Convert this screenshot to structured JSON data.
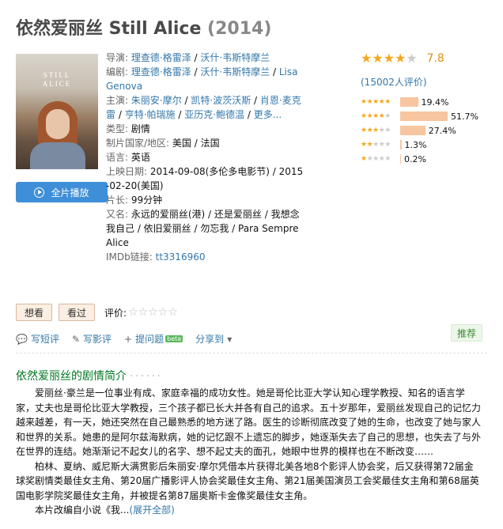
{
  "title": {
    "name": "依然爱丽丝 Still Alice",
    "year": "(2014)"
  },
  "poster": {
    "text": "STILL\nALICE",
    "alt": "poster"
  },
  "play_button": {
    "label": "全片播放",
    "icon": "play-circle-icon"
  },
  "info": {
    "director_label": "导演:",
    "director": [
      "理查德·格雷泽",
      "沃什·韦斯特摩兰"
    ],
    "writer_label": "编剧:",
    "writer": [
      "理查德·格雷泽",
      "沃什·韦斯特摩兰",
      "Lisa Genova"
    ],
    "cast_label": "主演:",
    "cast": [
      "朱丽安·摩尔",
      "凯特·波茨沃斯",
      "肖恩·麦克雷",
      "亨特·帕瑞施",
      "亚历克·鲍德温",
      "更多..."
    ],
    "genre_label": "类型:",
    "genre": "剧情",
    "country_label": "制片国家/地区:",
    "country": "美国 / 法国",
    "language_label": "语言:",
    "language": "英语",
    "release_label": "上映日期:",
    "release": "2014-09-08(多伦多电影节) / 2015-02-20(美国)",
    "runtime_label": "片长:",
    "runtime": "99分钟",
    "aka_label": "又名:",
    "aka": "永远的爱丽丝(港) / 还是爱丽丝 / 我想念我自己 / 依旧爱丽丝 / 勿忘我 / Para Sempre Alice",
    "imdb_label": "IMDb链接:",
    "imdb": "tt3316960"
  },
  "rating": {
    "score": "7.8",
    "stars_filled": 4,
    "votes": "(15002人评价)",
    "distribution": [
      {
        "stars": 5,
        "percent": "19.4%",
        "value": 19.4
      },
      {
        "stars": 4,
        "percent": "51.7%",
        "value": 51.7
      },
      {
        "stars": 3,
        "percent": "27.4%",
        "value": 27.4
      },
      {
        "stars": 2,
        "percent": "1.3%",
        "value": 1.3
      },
      {
        "stars": 1,
        "percent": "0.2%",
        "value": 0.2
      }
    ],
    "star_color": "#f4a81d"
  },
  "actions": {
    "want": "想看",
    "seen": "看过",
    "rate_label": "评价:"
  },
  "tools": {
    "short_review": "写短评",
    "review": "写影评",
    "question": "提问题",
    "beta": "beta",
    "share": "分享到"
  },
  "recommend": "推荐",
  "summary": {
    "title": "依然爱丽丝的剧情简介",
    "dots": "· · · · · ·",
    "p1": "爱丽丝·豪兰是一位事业有成、家庭幸福的成功女性。她是哥伦比亚大学认知心理学教授、知名的语言学家，丈夫也是哥伦比亚大学教授，三个孩子都已长大并各有自己的追求。五十岁那年，爱丽丝发现自己的记忆力越来越差，有一天，她还突然在自己最熟悉的地方迷了路。医生的诊断彻底改变了她的生命，也改变了她与家人和世界的关系。她患的是阿尔兹海默病，她的记忆跟不上遗忘的脚步，她逐渐失去了自己的思想，也失去了与外在世界的连结。她渐渐记不起女儿的名字、想不起丈夫的面孔，她眼中世界的模样也在不断改变……",
    "p2": "柏林、夏纳、威尼斯大满贯影后朱丽安·摩尔凭借本片获得北美各地8个影评人协会奖，后又获得第72届金球奖剧情类最佳女主角、第20届广播影评人协会奖最佳女主角、第21届美国演员工会奖最佳女主角和第68届英国电影学院奖最佳女主角，并被提名第87届奥斯卡金像奖最佳女主角。",
    "p3": "本片改编自小说《我...",
    "more": "(展开全部)"
  }
}
